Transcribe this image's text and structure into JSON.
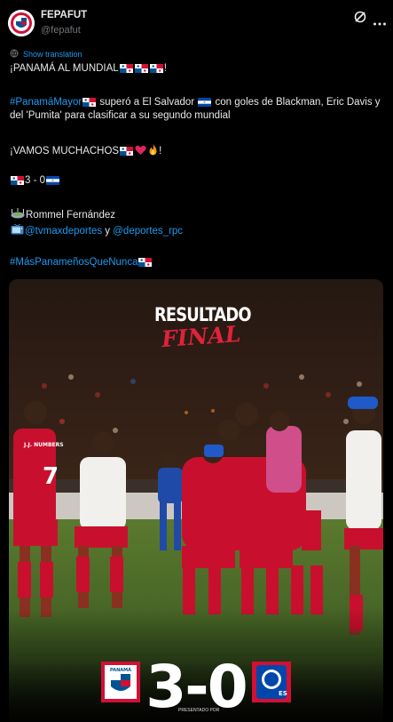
{
  "author": {
    "name": "FEPAFUT",
    "handle": "@fepafut"
  },
  "translate_label": "Show translation",
  "icons": {
    "grok": "grok-icon",
    "more": "more-icon",
    "globe": "globe-icon",
    "stadium": "stadium-icon",
    "tv": "tv-icon"
  },
  "tweet": {
    "line1": "¡PANAMÁ AL MUNDIAL",
    "line1_end": "!",
    "hashtag_main": "#PanamáMayor",
    "para2_a": " superó a El Salvador ",
    "para2_b": " con goles de Blackman, Eric Davis y del 'Pumita' para clasificar a su segundo mundial",
    "line3": "¡VAMOS MUCHACHOS ",
    "line3_end": "!",
    "score_line": " 3 - 0 ",
    "commentator": " Rommel Fernández",
    "broadcaster1": "@tvmaxdeportes",
    "connector": " y ",
    "broadcaster2": "@deportes_rpc",
    "hashtag_end": "#MásPanameñosQueNunca"
  },
  "media": {
    "title_top": "RESULTADO",
    "title_final": "FINAL",
    "score": "3-0",
    "presented_by": "PRESENTADO POR",
    "home_badge_label": "PANAMÁ",
    "away_badge_label": "ES",
    "jersey_name": "J.J. NUMBERS",
    "jersey_number": "7"
  },
  "colors": {
    "background": "#000000",
    "text": "#e7e9ea",
    "muted": "#71767b",
    "link": "#1d9bf0",
    "panama_red": "#d21034",
    "panama_blue": "#005293",
    "salvador_blue": "#0047ab"
  }
}
